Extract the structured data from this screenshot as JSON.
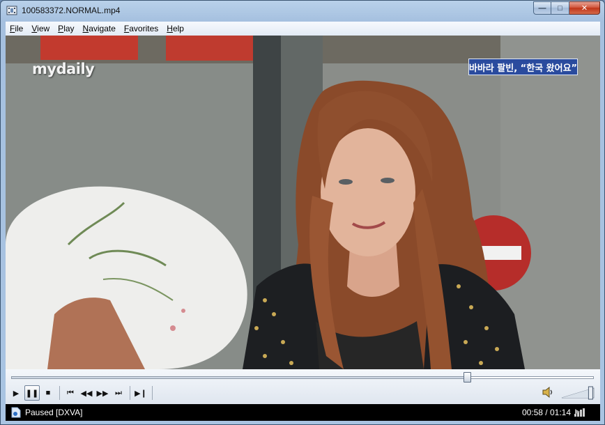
{
  "window": {
    "title": "100583372.NORMAL.mp4",
    "buttons": {
      "minimize": "—",
      "maximize": "□",
      "close": "✕"
    }
  },
  "menu": {
    "items": [
      {
        "acc": "F",
        "rest": "ile"
      },
      {
        "acc": "V",
        "rest": "iew"
      },
      {
        "acc": "P",
        "rest": "lay"
      },
      {
        "acc": "N",
        "rest": "avigate"
      },
      {
        "acc": "F",
        "rest": "avorites"
      },
      {
        "acc": "H",
        "rest": "elp"
      }
    ]
  },
  "video": {
    "watermark": "mydaily",
    "caption": "바바라 팔빈, “한국 왔어요”"
  },
  "playback": {
    "progress": 0.7838,
    "buttons": {
      "play": "▶",
      "pause": "❚❚",
      "stop": "■",
      "prev": "⏮",
      "rewind": "◀◀",
      "forward": "▶▶",
      "next": "⏭",
      "frame_step": "▶❙"
    },
    "volume_level": 0.9
  },
  "status": {
    "text": "Paused [DXVA]",
    "time": "00:58 / 01:14"
  }
}
